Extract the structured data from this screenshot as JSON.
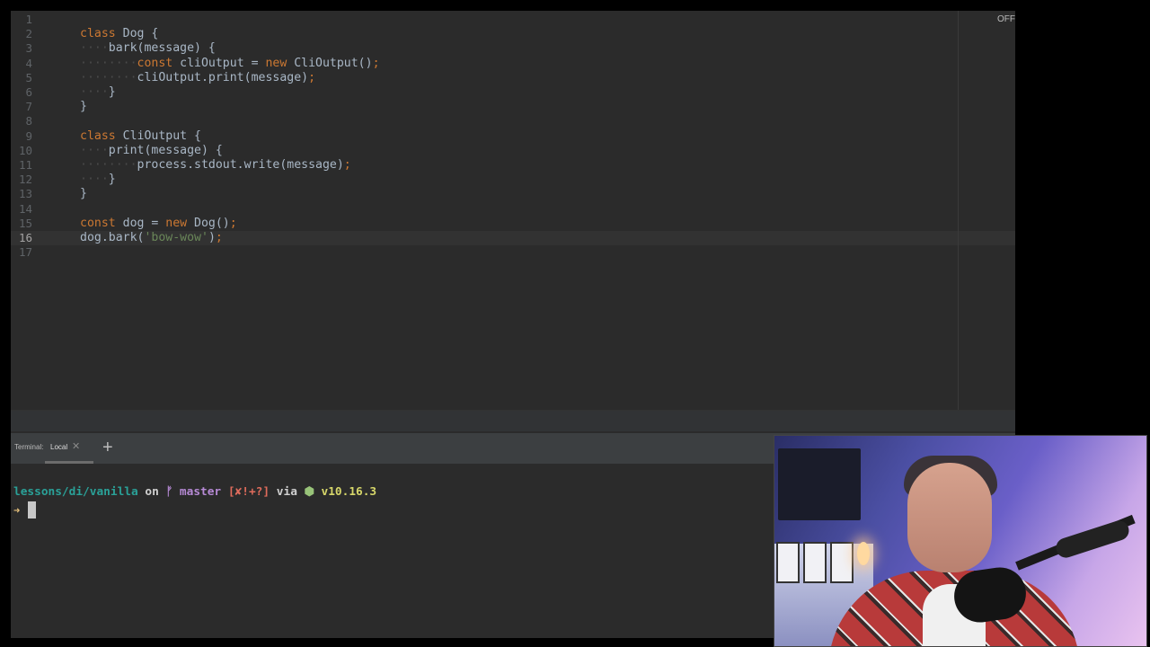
{
  "editor": {
    "status_badge": "OFF",
    "current_line": 16,
    "line_numbers": [
      "1",
      "2",
      "3",
      "4",
      "5",
      "6",
      "7",
      "8",
      "9",
      "10",
      "11",
      "12",
      "13",
      "14",
      "15",
      "16",
      "17"
    ],
    "lines": [
      {
        "indent": "",
        "tokens": []
      },
      {
        "indent": "",
        "tokens": [
          {
            "t": "kw",
            "v": "class"
          },
          {
            "t": "pl",
            "v": " Dog {"
          }
        ]
      },
      {
        "indent": "····",
        "tokens": [
          {
            "t": "pl",
            "v": "bark(message) {"
          }
        ]
      },
      {
        "indent": "········",
        "tokens": [
          {
            "t": "kw",
            "v": "const"
          },
          {
            "t": "pl",
            "v": " cliOutput = "
          },
          {
            "t": "kw",
            "v": "new"
          },
          {
            "t": "pl",
            "v": " CliOutput()"
          },
          {
            "t": "kw",
            "v": ";"
          }
        ]
      },
      {
        "indent": "········",
        "tokens": [
          {
            "t": "pl",
            "v": "cliOutput.print(message)"
          },
          {
            "t": "kw",
            "v": ";"
          }
        ]
      },
      {
        "indent": "····",
        "tokens": [
          {
            "t": "pl",
            "v": "}"
          }
        ]
      },
      {
        "indent": "",
        "tokens": [
          {
            "t": "pl",
            "v": "}"
          }
        ]
      },
      {
        "indent": "",
        "tokens": []
      },
      {
        "indent": "",
        "tokens": [
          {
            "t": "kw",
            "v": "class"
          },
          {
            "t": "pl",
            "v": " CliOutput {"
          }
        ]
      },
      {
        "indent": "····",
        "tokens": [
          {
            "t": "pl",
            "v": "print(message) {"
          }
        ]
      },
      {
        "indent": "········",
        "tokens": [
          {
            "t": "pl",
            "v": "process.stdout.write(message)"
          },
          {
            "t": "kw",
            "v": ";"
          }
        ]
      },
      {
        "indent": "····",
        "tokens": [
          {
            "t": "pl",
            "v": "}"
          }
        ]
      },
      {
        "indent": "",
        "tokens": [
          {
            "t": "pl",
            "v": "}"
          }
        ]
      },
      {
        "indent": "",
        "tokens": []
      },
      {
        "indent": "",
        "tokens": [
          {
            "t": "kw",
            "v": "const"
          },
          {
            "t": "pl",
            "v": " dog = "
          },
          {
            "t": "kw",
            "v": "new"
          },
          {
            "t": "pl",
            "v": " Dog()"
          },
          {
            "t": "kw",
            "v": ";"
          }
        ]
      },
      {
        "indent": "",
        "tokens": [
          {
            "t": "pl",
            "v": "dog.bark("
          },
          {
            "t": "str",
            "v": "'bow-wow'"
          },
          {
            "t": "pl",
            "v": ")"
          },
          {
            "t": "kw",
            "v": ";"
          }
        ]
      },
      {
        "indent": "",
        "tokens": []
      }
    ]
  },
  "terminal": {
    "label": "Terminal:",
    "tab_name": "Local",
    "close_glyph": "✕",
    "add_glyph": "+",
    "prompt": {
      "path": "lessons/di/vanilla",
      "on": " on ",
      "branch_icon": "ᚠ",
      "branch": " master",
      "status": " [✘!+?]",
      "via": " via ",
      "node_dot": "⬢",
      "node_version": " v10.16.3"
    },
    "arrow": "➜"
  },
  "colors": {
    "keyword": "#cc7832",
    "string": "#6a8759",
    "plain": "#a9b7c6",
    "path": "#2aa198",
    "branch": "#b78ad6",
    "status": "#e06c5c",
    "node": "#d7d76a"
  }
}
